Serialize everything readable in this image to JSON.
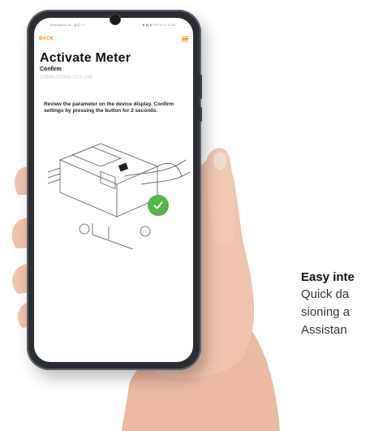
{
  "phone": {
    "status_left": "Emergency ca.. 🖫 ✆ ✉",
    "status_right": "◉ ▦ ▮ ⦿97% ▭ 12:55",
    "back_label": "BACK",
    "title": "Activate Meter",
    "subtitle": "Confirm",
    "serial": "22640-00000-022-246",
    "instruction": "Review the parameter on the device display. Confirm settings by pressing the button for 2 seconds.",
    "icons": {
      "menu": "hamburger-menu-icon",
      "check": "checkmark-icon"
    },
    "colors": {
      "accent": "#f39200",
      "success": "#52b64a"
    }
  },
  "caption": {
    "title": "Easy inte",
    "lines": [
      "Quick da",
      "sioning a",
      "Assistan"
    ]
  }
}
